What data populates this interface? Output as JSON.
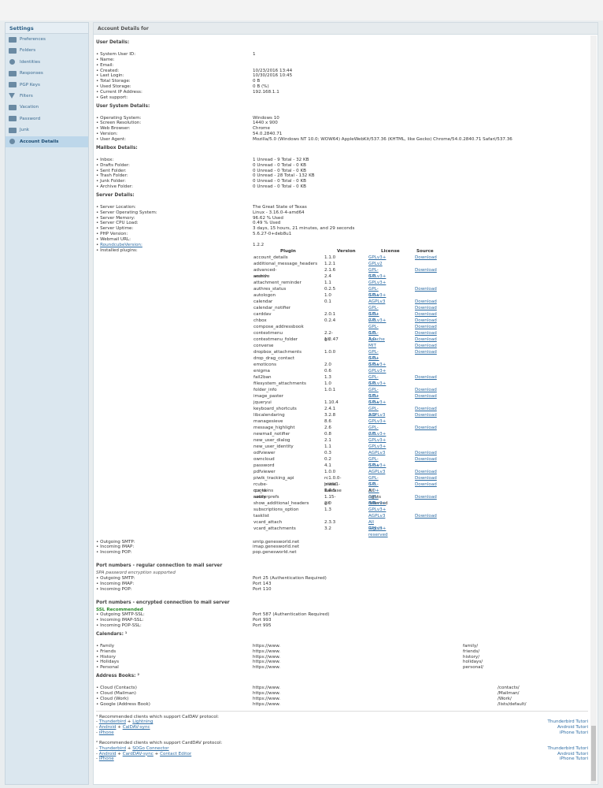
{
  "sidebar": {
    "title": "Settings",
    "items": [
      {
        "label": "Preferences",
        "icon": "preferences-icon"
      },
      {
        "label": "Folders",
        "icon": "folder-icon"
      },
      {
        "label": "Identities",
        "icon": "identities-icon"
      },
      {
        "label": "Responses",
        "icon": "responses-icon"
      },
      {
        "label": "PGP Keys",
        "icon": "key-icon"
      },
      {
        "label": "Filters",
        "icon": "filter-icon"
      },
      {
        "label": "Vacation",
        "icon": "vacation-icon"
      },
      {
        "label": "Password",
        "icon": "password-icon"
      },
      {
        "label": "Junk",
        "icon": "junk-icon"
      },
      {
        "label": "Account Details",
        "icon": "gear-icon",
        "selected": true
      }
    ]
  },
  "main": {
    "title": "Account Details for"
  },
  "user": {
    "heading": "User Details:",
    "rows": [
      [
        "• System User ID:",
        "1"
      ],
      [
        "• Name:",
        ""
      ],
      [
        "• Email:",
        ""
      ],
      [
        "• Created:",
        "10/23/2016 13:44"
      ],
      [
        "• Last Login:",
        "10/30/2016 10:45"
      ],
      [
        "• Total Storage:",
        "0 B"
      ],
      [
        "• Used Storage:",
        "0 B (%)"
      ],
      [
        "• Current IP Address:",
        "192.168.1.1"
      ],
      [
        "• Get support:",
        ""
      ]
    ]
  },
  "system": {
    "heading": "User System Details:",
    "rows": [
      [
        "• Operating System:",
        "Windows 10"
      ],
      [
        "• Screen Resolution:",
        "1440 x 900"
      ],
      [
        "• Web Browser:",
        "Chrome"
      ],
      [
        " • Version:",
        "54.0.2840.71"
      ],
      [
        " • User Agent:",
        "Mozilla/5.0 (Windows NT 10.0; WOW64) AppleWebKit/537.36 (KHTML, like Gecko) Chrome/54.0.2840.71 Safari/537.36"
      ]
    ]
  },
  "mailbox": {
    "heading": "Mailbox Details:",
    "rows": [
      [
        "• Inbox:",
        "1 Unread - 9 Total - 32 KB"
      ],
      [
        "• Drafts Folder:",
        "0 Unread - 0 Total - 0 KB"
      ],
      [
        "• Sent Folder:",
        "0 Unread - 0 Total - 0 KB"
      ],
      [
        "• Trash Folder:",
        "0 Unread - 28 Total - 132 KB"
      ],
      [
        "• Junk Folder:",
        "0 Unread - 0 Total - 0 KB"
      ],
      [
        "• Archive Folder:",
        "0 Unread - 0 Total - 0 KB"
      ]
    ]
  },
  "server": {
    "heading": "Server Details:",
    "rows": [
      [
        "• Server Location:",
        "The Great State of Texas"
      ],
      [
        "• Server Operating System:",
        "Linux - 3.16.0-4-amd64"
      ],
      [
        "• Server Memory:",
        "96.62 % Used"
      ],
      [
        "• Server CPU Load:",
        "0.49 % Used"
      ],
      [
        "• Server Uptime:",
        "3 days, 15 hours, 21 minutes, and 29 seconds"
      ],
      [
        "• PHP Version:",
        "5.6.27-0+deb8u1"
      ],
      [
        "• Webmail URL:",
        ""
      ]
    ],
    "rc_label": "RoundcubeVersion:",
    "rc_value": "1.2.2",
    "plugins_label": " • Installed plugins:"
  },
  "plugins": {
    "headers": [
      "Plugin",
      "Version",
      "License",
      "Source"
    ],
    "rows": [
      [
        "account_details",
        "1.1.0",
        "GPLv3+",
        "Download"
      ],
      [
        "additional_message_headers",
        "1.2.1",
        "GPLv2",
        ""
      ],
      [
        "advanced-search",
        "2.1.6",
        "GPL-3.0",
        "Download"
      ],
      [
        "archive",
        "2.4",
        "GPLv3+",
        ""
      ],
      [
        "attachment_reminder",
        "1.1",
        "GPLv3+",
        ""
      ],
      [
        "authres_status",
        "0.2.5",
        "GPL-3.0+",
        "Download"
      ],
      [
        "autologon",
        "1.0",
        "GPLv3+",
        ""
      ],
      [
        "calendar",
        "0.1",
        "AGPLv3",
        "Download"
      ],
      [
        "calendar_notifier",
        "",
        "GPL-3.0+",
        "Download"
      ],
      [
        "carddav",
        "2.0.1",
        "GPL-2.0",
        "Download"
      ],
      [
        "chbox",
        "0.2.4",
        "GPLv3+",
        "Download"
      ],
      [
        "compose_addressbook",
        "",
        "GPL-3.0",
        "Download"
      ],
      [
        "contextmenu",
        "2.2-git",
        "GPL-3.0",
        "Download"
      ],
      [
        "contextmenu_folder",
        "1.2.47",
        "Apache",
        "Download"
      ],
      [
        "converse",
        "",
        "MIT",
        "Download"
      ],
      [
        "dropbox_attachments",
        "1.0.0",
        "GPL-3.0+",
        "Download"
      ],
      [
        "drop_drag_contact",
        "",
        "GPL-3.0+",
        ""
      ],
      [
        "emoticons",
        "2.0",
        "GPLv3+",
        ""
      ],
      [
        "enigma",
        "0.6",
        "GPLv3+",
        ""
      ],
      [
        "fail2ban",
        "1.3",
        "GPL-3.0",
        "Download"
      ],
      [
        "filesystem_attachments",
        "1.0",
        "GPLv3+",
        ""
      ],
      [
        "folder_info",
        "1.0.1",
        "GPL-3.0+",
        "Download"
      ],
      [
        "image_paster",
        "",
        "GPL-3.0+",
        "Download"
      ],
      [
        "jqueryui",
        "1.10.4",
        "GPLv3+",
        ""
      ],
      [
        "keyboard_shortcuts",
        "2.4.1",
        "GPL-2.0",
        "Download"
      ],
      [
        "libcalendaring",
        "3.2.8",
        "AGPLv3",
        "Download"
      ],
      [
        "managesieve",
        "8.6",
        "GPLv3+",
        ""
      ],
      [
        "message_highlight",
        "2.6",
        "GPL-2.0",
        "Download"
      ],
      [
        "newmail_notifier",
        "0.8",
        "GPLv3+",
        ""
      ],
      [
        "new_user_dialog",
        "2.1",
        "GPLv3+",
        ""
      ],
      [
        "new_user_identity",
        "1.1",
        "GPLv3+",
        ""
      ],
      [
        "odfviewer",
        "0.3",
        "AGPLv3",
        "Download"
      ],
      [
        "owncloud",
        "0.2",
        "GPL-3.0+",
        "Download"
      ],
      [
        "password",
        "4.1",
        "GPLv3+",
        ""
      ],
      [
        "pdfviewer",
        "1.0.0",
        "AGPLv3",
        "Download"
      ],
      [
        "piwik_tracking_api",
        "rc1.0.0-piwik1-1.2",
        "GPL-3.0",
        "Download"
      ],
      [
        "rcube-quota-notify",
        "Initial Release",
        "GPL-3.0+",
        "Download"
      ],
      [
        "rcs_skins",
        "1.4.5",
        "All rights reserved",
        ""
      ],
      [
        "sauserprefs",
        "1.15-git",
        "GPL-3.0",
        "Download"
      ],
      [
        "show_additional_headers",
        "2.0",
        "GPLv3+",
        ""
      ],
      [
        "subscriptions_option",
        "1.3",
        "GPLv3+",
        ""
      ],
      [
        "tasklist",
        "",
        "AGPLv3",
        "Download"
      ],
      [
        "vcard_attach",
        "2.3.3",
        "All Rights reserved",
        ""
      ],
      [
        "vcard_attachments",
        "3.2",
        "GPLv3+",
        ""
      ]
    ]
  },
  "hosts": {
    "rows": [
      [
        "• Outgoing SMTP:",
        "smtp.genesworld.net"
      ],
      [
        "• Incoming IMAP:",
        "imap.genesworld.net"
      ],
      [
        "• Incoming POP:",
        "pop.genesworld.net"
      ]
    ]
  },
  "ports_regular": {
    "heading": "Port numbers - regular connection to mail server",
    "note": "SPA password encryption supported",
    "rows": [
      [
        "• Outgoing SMTP:",
        "Port 25 (Authentication Required)"
      ],
      [
        "• Incoming IMAP:",
        "Port 143"
      ],
      [
        "• Incoming POP:",
        "Port 110"
      ]
    ]
  },
  "ports_ssl": {
    "heading": "Port numbers - encrypted connection to mail server",
    "note": "SSL Recommended",
    "rows": [
      [
        "• Outgoing SMTP-SSL:",
        "Port 587 (Authentication Required)"
      ],
      [
        "• Incoming IMAP-SSL:",
        "Port 993"
      ],
      [
        "• Incoming POP-SSL:",
        "Port 995"
      ]
    ]
  },
  "calendars": {
    "heading": "Calendars: ¹",
    "rows": [
      [
        "• Family",
        "https://www.",
        "family/"
      ],
      [
        "• Friends",
        "https://www.",
        "friends/"
      ],
      [
        "• History",
        "https://www.",
        "history/"
      ],
      [
        "• Holidays",
        "https://www.",
        "holidays/"
      ],
      [
        "• Personal",
        "https://www.",
        "personal/"
      ]
    ]
  },
  "addressbooks": {
    "heading": "Address Books: ²",
    "rows": [
      [
        "• Cloud (Contacts)",
        "https://www.",
        "/contacts/"
      ],
      [
        "• Cloud (Mailman)",
        "https://www.",
        "/Mailman/"
      ],
      [
        "• Cloud (Work)",
        "https://www.",
        "/Work/"
      ],
      [
        "• Google (Address Book)",
        "https://www.",
        "/lists/default/"
      ]
    ]
  },
  "footnote1": {
    "intro": "¹ Recommended clients which support CalDAV protocol:",
    "lines": [
      [
        "- ",
        "Thunderbird",
        " + ",
        "Lightning",
        "Thunderbird Tutorial"
      ],
      [
        "- ",
        "Android",
        " + ",
        "CalDAV-sync",
        "Android Tutorial"
      ],
      [
        "- ",
        "iPhone",
        "",
        "",
        "iPhone Tutorial"
      ]
    ]
  },
  "footnote2": {
    "intro": "² Recommended clients which support CardDAV protocol:",
    "lines": [
      [
        "- ",
        "Thunderbird",
        " + ",
        "SOGo Connector",
        "Thunderbird Tutorial"
      ],
      [
        "- ",
        "Android",
        " + ",
        "CardDAV-sync",
        " + Contact Editor",
        "Android Tutorial"
      ],
      [
        "- ",
        "iPhone",
        "",
        "",
        "iPhone Tutorial"
      ]
    ]
  }
}
